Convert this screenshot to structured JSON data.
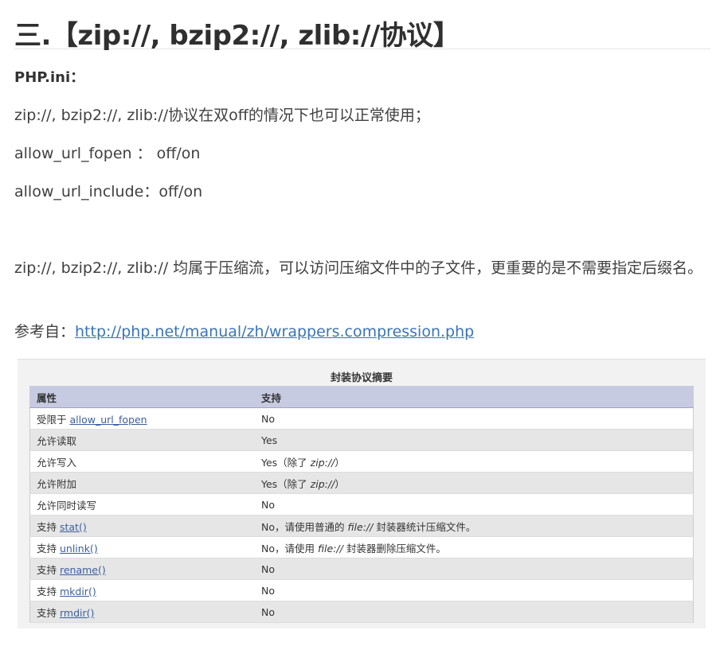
{
  "heading": "三.【zip://, bzip2://, zlib://协议】",
  "ini_label": "PHP.ini：",
  "line_normal": "zip://, bzip2://, zlib://协议在双off的情况下也可以正常使用；",
  "line_fopen": "allow_url_fopen ： off/on",
  "line_include": "allow_url_include：off/on",
  "line_desc": "zip://, bzip2://, zlib:// 均属于压缩流，可以访问压缩文件中的子文件，更重要的是不需要指定后缀名。",
  "ref_prefix": "参考自：",
  "ref_link": "http://php.net/manual/zh/wrappers.compression.php",
  "table": {
    "caption": "封装协议摘要",
    "headers": [
      "属性",
      "支持"
    ],
    "rows": [
      {
        "pre": "受限于 ",
        "link": "allow_url_fopen",
        "post": "",
        "value": "No"
      },
      {
        "pre": "允许读取",
        "link": "",
        "post": "",
        "value": "Yes"
      },
      {
        "pre": "允许写入",
        "link": "",
        "post": "",
        "value_pre": "Yes（除了 ",
        "value_em": "zip://",
        "value_post": "）"
      },
      {
        "pre": "允许附加",
        "link": "",
        "post": "",
        "value_pre": "Yes（除了 ",
        "value_em": "zip://",
        "value_post": "）"
      },
      {
        "pre": "允许同时读写",
        "link": "",
        "post": "",
        "value": "No"
      },
      {
        "pre": "支持 ",
        "link": "stat()",
        "post": "",
        "value_pre": "No，请使用普通的 ",
        "value_em": "file://",
        "value_post": " 封装器统计压缩文件。"
      },
      {
        "pre": "支持 ",
        "link": "unlink()",
        "post": "",
        "value_pre": "No，请使用 ",
        "value_em": "file://",
        "value_post": " 封装器删除压缩文件。"
      },
      {
        "pre": "支持 ",
        "link": "rename()",
        "post": "",
        "value": "No"
      },
      {
        "pre": "支持 ",
        "link": "mkdir()",
        "post": "",
        "value": "No"
      },
      {
        "pre": "支持 ",
        "link": "rmdir()",
        "post": "",
        "value": "No"
      }
    ]
  }
}
